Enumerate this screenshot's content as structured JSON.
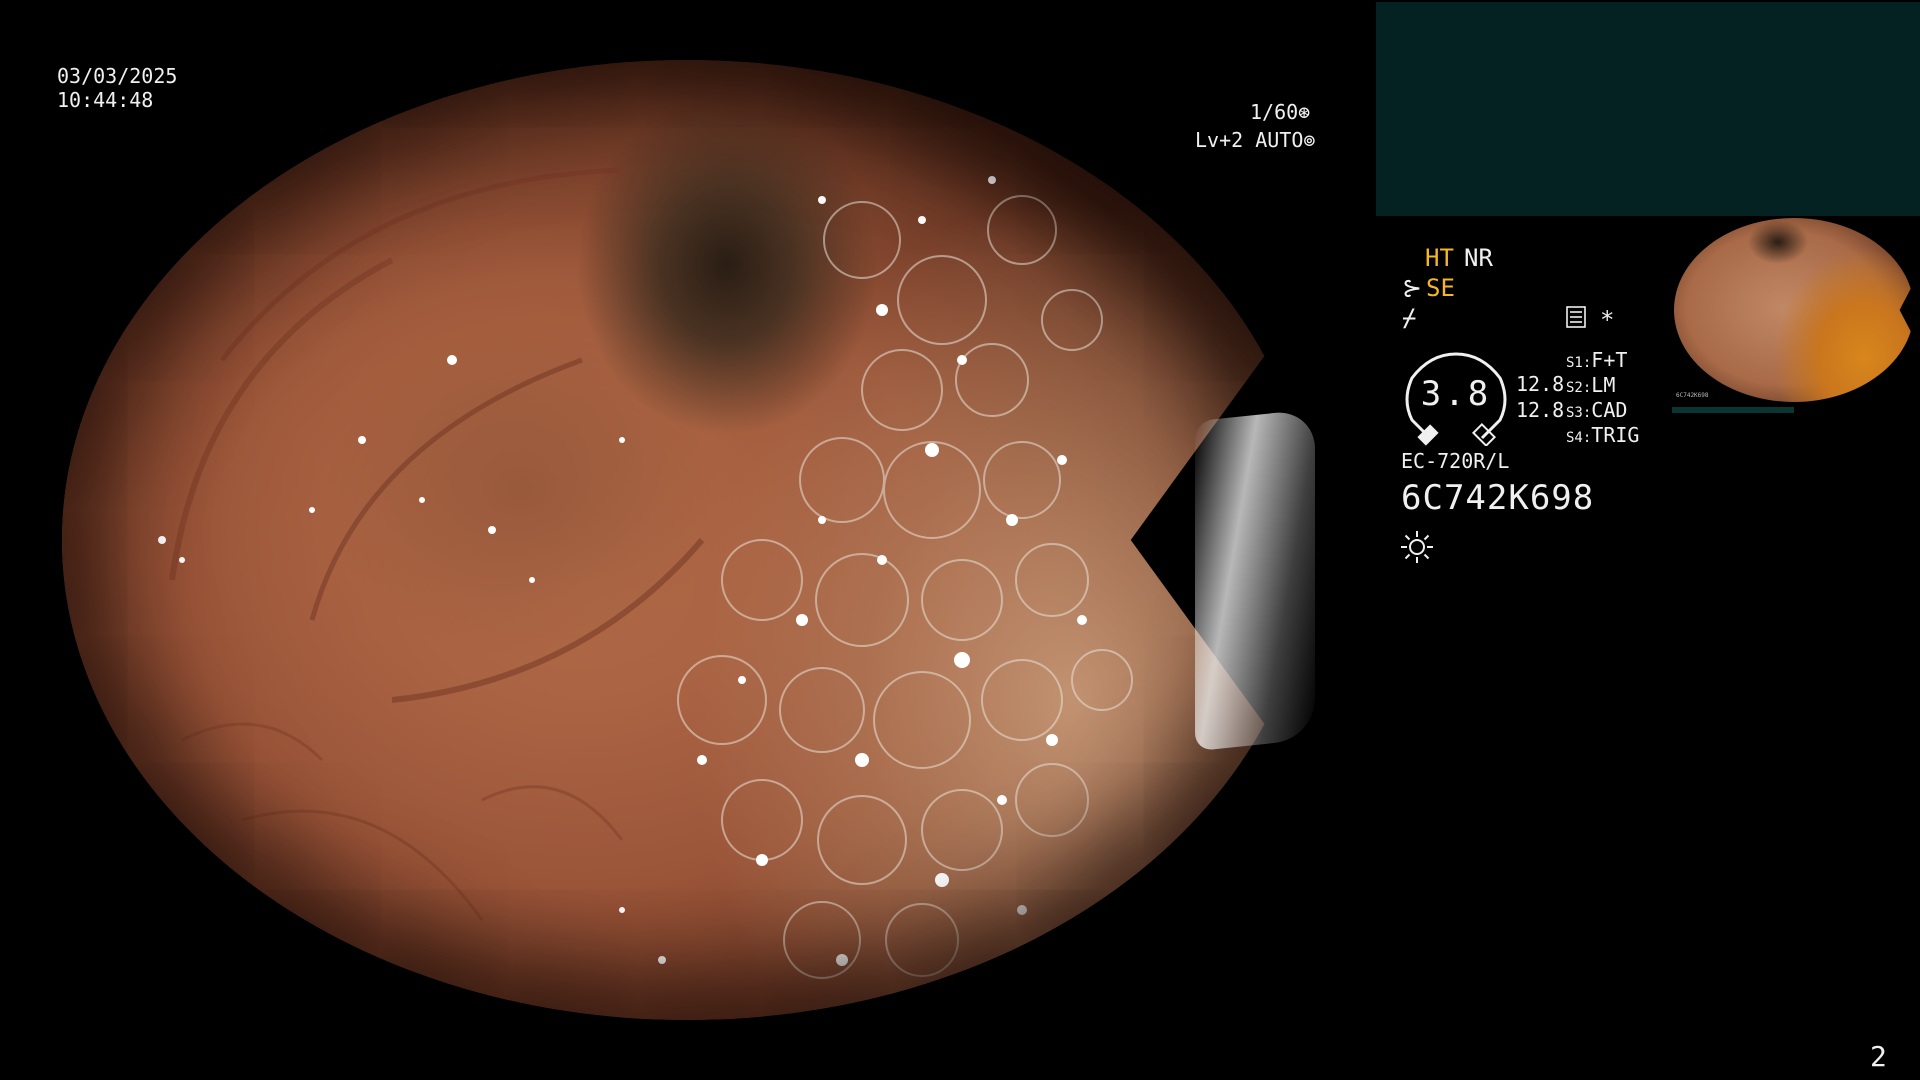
{
  "overlay": {
    "date": "03/03/2025",
    "time": "10:44:48",
    "shutter": "1/60",
    "level": "Lv+2 AUTO"
  },
  "panel": {
    "ht": "HT",
    "nr": "NR",
    "se": "SE",
    "gauge_value": "3.8",
    "gauge_side_1": "12.8",
    "gauge_side_2": "12.8",
    "switches": [
      {
        "key": "S1:",
        "value": "F+T"
      },
      {
        "key": "S2:",
        "value": "LM"
      },
      {
        "key": "S3:",
        "value": "CAD"
      },
      {
        "key": "S4:",
        "value": "TRIG"
      }
    ],
    "model": "EC-720R/L",
    "serial": "6C742K698"
  },
  "thumbnail": {
    "label": "6C742K698"
  },
  "page_number": "2",
  "colors": {
    "text": "#f0f0f0",
    "accent_yellow": "#f5b72a",
    "teal_panel": "#042221"
  },
  "icons": [
    "shutter-icon",
    "iris-icon",
    "scope-se-icon",
    "adjust-icon",
    "menu-list-icon",
    "star-icon",
    "brightness-sun-icon"
  ]
}
